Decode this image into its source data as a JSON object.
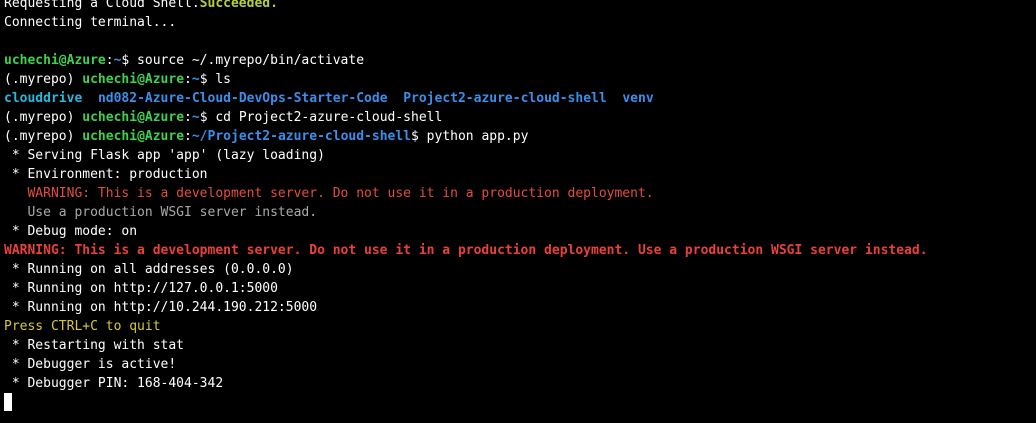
{
  "terminal": {
    "lines": [
      [
        {
          "text": "Requesting a Cloud Shell.",
          "color": "default"
        },
        {
          "text": "Succeeded.",
          "color": "yellow-green-bold"
        }
      ],
      [
        {
          "text": "Connecting terminal...",
          "color": "default"
        }
      ],
      [],
      [
        {
          "text": "uchechi@Azure",
          "color": "green-bold"
        },
        {
          "text": ":",
          "color": "default"
        },
        {
          "text": "~",
          "color": "blue-bold"
        },
        {
          "text": "$ source ~/.myrepo/bin/activate",
          "color": "default"
        }
      ],
      [
        {
          "text": "(.myrepo) ",
          "color": "default"
        },
        {
          "text": "uchechi@Azure",
          "color": "green-bold"
        },
        {
          "text": ":",
          "color": "default"
        },
        {
          "text": "~",
          "color": "blue-bold"
        },
        {
          "text": "$ ls",
          "color": "default"
        }
      ],
      [
        {
          "text": "clouddrive",
          "color": "cyan-bold"
        },
        {
          "text": "  ",
          "color": "default"
        },
        {
          "text": "nd082-Azure-Cloud-DevOps-Starter-Code",
          "color": "blue-bold"
        },
        {
          "text": "  ",
          "color": "default"
        },
        {
          "text": "Project2-azure-cloud-shell",
          "color": "blue-bold"
        },
        {
          "text": "  ",
          "color": "default"
        },
        {
          "text": "venv",
          "color": "blue-bold"
        }
      ],
      [
        {
          "text": "(.myrepo) ",
          "color": "default"
        },
        {
          "text": "uchechi@Azure",
          "color": "green-bold"
        },
        {
          "text": ":",
          "color": "default"
        },
        {
          "text": "~",
          "color": "blue-bold"
        },
        {
          "text": "$ cd Project2-azure-cloud-shell",
          "color": "default"
        }
      ],
      [
        {
          "text": "(.myrepo) ",
          "color": "default"
        },
        {
          "text": "uchechi@Azure",
          "color": "green-bold"
        },
        {
          "text": ":",
          "color": "default"
        },
        {
          "text": "~/Project2-azure-cloud-shell",
          "color": "blue-bold"
        },
        {
          "text": "$ python app.py",
          "color": "default"
        }
      ],
      [
        {
          "text": " * Serving Flask app 'app' (lazy loading)",
          "color": "default"
        }
      ],
      [
        {
          "text": " * Environment: production",
          "color": "default"
        }
      ],
      [
        {
          "text": "   WARNING: This is a development server. Do not use it in a production deployment.",
          "color": "red"
        }
      ],
      [
        {
          "text": "   Use a production WSGI server instead.",
          "color": "gray"
        }
      ],
      [
        {
          "text": " * Debug mode: on",
          "color": "default"
        }
      ],
      [
        {
          "text": "WARNING: This is a development server. Do not use it in a production deployment. Use a production WSGI server instead.",
          "color": "red-bold"
        }
      ],
      [
        {
          "text": " * Running on all addresses (0.0.0.0)",
          "color": "default"
        }
      ],
      [
        {
          "text": " * Running on http://127.0.0.1:5000",
          "color": "default"
        }
      ],
      [
        {
          "text": " * Running on http://10.244.190.212:5000",
          "color": "default"
        }
      ],
      [
        {
          "text": "Press CTRL+C to quit",
          "color": "yellow"
        }
      ],
      [
        {
          "text": " * Restarting with stat",
          "color": "default"
        }
      ],
      [
        {
          "text": " * Debugger is active!",
          "color": "default"
        }
      ],
      [
        {
          "text": " * Debugger PIN: 168-404-342",
          "color": "default"
        }
      ]
    ],
    "colors": {
      "background": "#000000",
      "default": "#ffffff",
      "green": "#3fd04f",
      "blue": "#3b8eea",
      "cyan": "#29b8db",
      "yellow_green": "#b5ce3c",
      "red": "#e24d3d",
      "red_bold": "#e8413a",
      "gray": "#a9a9a9",
      "yellow": "#d6c83d"
    },
    "cursor_visible": true
  }
}
